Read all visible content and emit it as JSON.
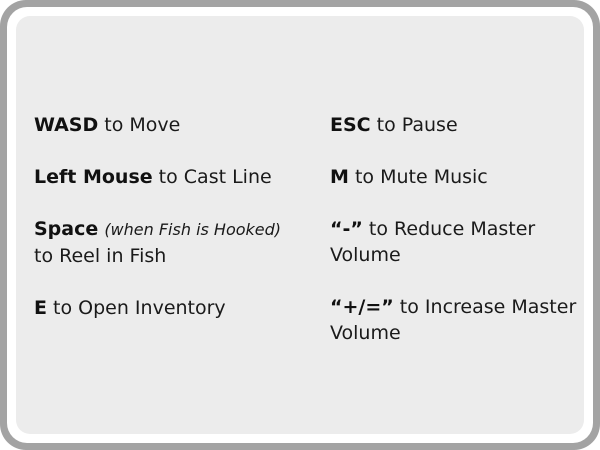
{
  "controls": {
    "left": [
      {
        "key": "WASD",
        "text": " to Move"
      },
      {
        "key": "Left Mouse",
        "text": " to Cast Line"
      },
      {
        "key": "Space",
        "note": "(when Fish is Hooked)",
        "text": "to Reel in Fish"
      },
      {
        "key": "E",
        "text": " to Open Inventory"
      }
    ],
    "right": [
      {
        "key": "ESC",
        "text": " to Pause"
      },
      {
        "key": "M",
        "text": " to Mute Music"
      },
      {
        "key": "“-”",
        "text": " to Reduce Master Volume"
      },
      {
        "key": "“+/=”",
        "text": " to Increase Master Volume"
      }
    ]
  }
}
